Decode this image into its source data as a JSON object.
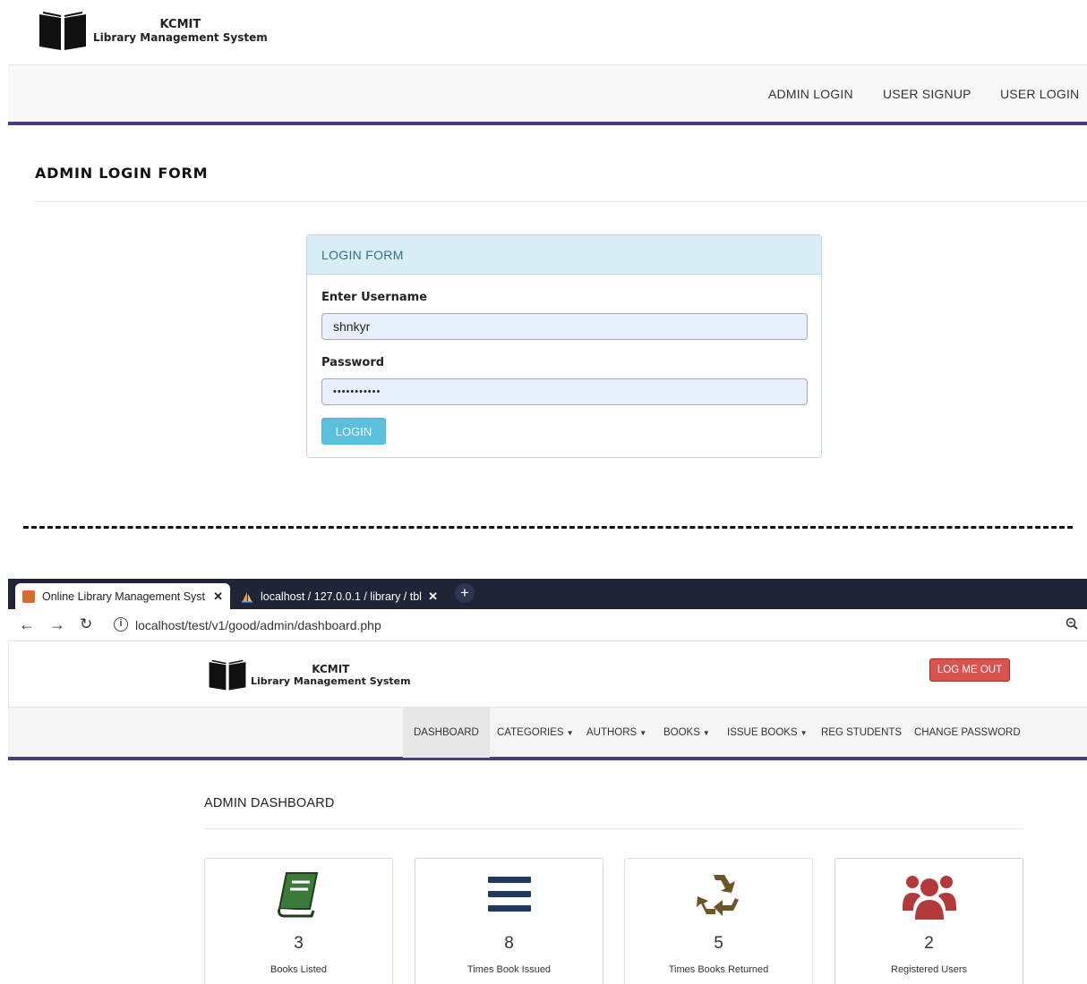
{
  "login_page": {
    "brand": {
      "line1": "KCMIT",
      "line2": "Library Management System"
    },
    "nav": [
      "ADMIN LOGIN",
      "USER SIGNUP",
      "USER LOGIN"
    ],
    "page_title": "ADMIN LOGIN FORM",
    "form": {
      "heading": "LOGIN FORM",
      "username_label": "Enter Username",
      "username_value": "shnkyr",
      "password_label": "Password",
      "password_value": "•••••••••••",
      "submit_label": "LOGIN"
    }
  },
  "browser": {
    "tabs": [
      {
        "title": "Online Library Management Syst",
        "active": true
      },
      {
        "title": "localhost / 127.0.0.1 / library / tbl",
        "active": false
      }
    ],
    "new_tab": "+",
    "url": "localhost/test/v1/good/admin/dashboard.php"
  },
  "dashboard": {
    "brand": {
      "line1": "KCMIT",
      "line2": "Library Management System"
    },
    "logout_label": "LOG ME OUT",
    "nav": [
      {
        "label": "DASHBOARD",
        "dropdown": false
      },
      {
        "label": "CATEGORIES",
        "dropdown": true
      },
      {
        "label": "AUTHORS",
        "dropdown": true
      },
      {
        "label": "BOOKS",
        "dropdown": true
      },
      {
        "label": "ISSUE BOOKS",
        "dropdown": true
      },
      {
        "label": "REG STUDENTS",
        "dropdown": false
      },
      {
        "label": "CHANGE PASSWORD",
        "dropdown": false
      }
    ],
    "title": "ADMIN DASHBOARD",
    "cards": [
      {
        "value": "3",
        "label": "Books Listed",
        "icon": "book-icon",
        "color": "#3c7a3c"
      },
      {
        "value": "8",
        "label": "Times Book Issued",
        "icon": "bars-icon",
        "color": "#1f3a5a"
      },
      {
        "value": "5",
        "label": "Times Books Returned",
        "icon": "recycle-icon",
        "color": "#6b5628"
      },
      {
        "value": "2",
        "label": "Registered Users",
        "icon": "users-icon",
        "color": "#b23a3a"
      }
    ]
  },
  "colors": {
    "accent": "#4a3b7a",
    "panel_head": "#d9edf7",
    "login_button": "#5bc0de",
    "logout_button": "#d9534f"
  }
}
